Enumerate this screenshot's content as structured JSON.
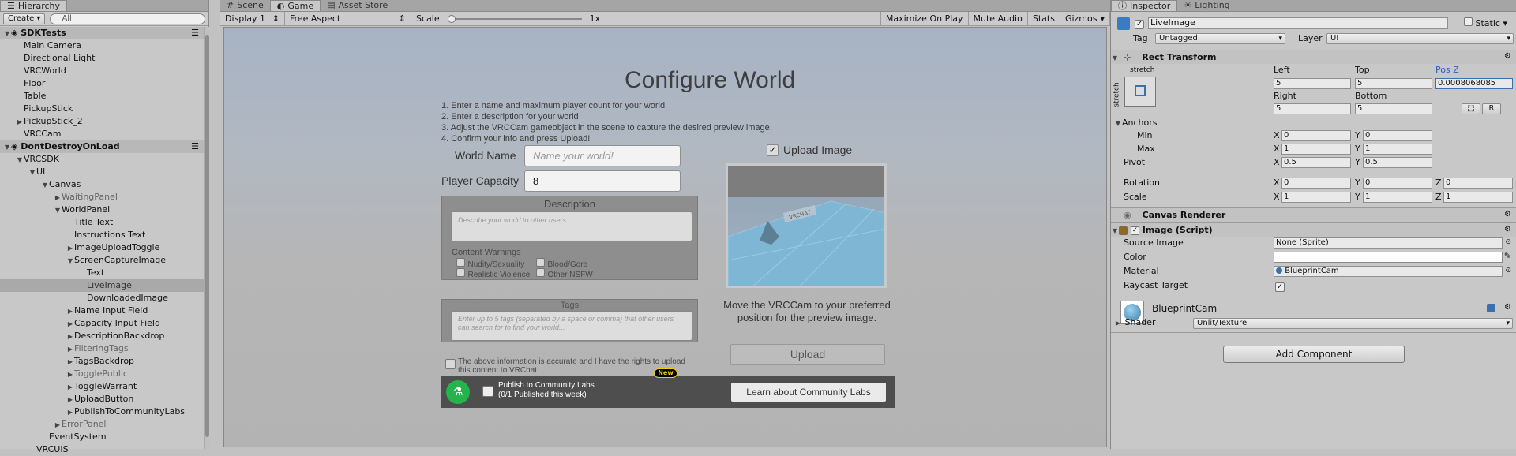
{
  "hierarchy": {
    "tab": "Hierarchy",
    "create": "Create",
    "search_placeholder": "All",
    "rows": [
      {
        "label": "SDKTests",
        "indent": 0,
        "arrow": "▼",
        "type": "header"
      },
      {
        "label": "Main Camera",
        "indent": 1
      },
      {
        "label": "Directional Light",
        "indent": 1
      },
      {
        "label": "VRCWorld",
        "indent": 1
      },
      {
        "label": "Floor",
        "indent": 1
      },
      {
        "label": "Table",
        "indent": 1
      },
      {
        "label": "PickupStick",
        "indent": 1
      },
      {
        "label": "PickupStick_2",
        "indent": 1,
        "arrow": "▶"
      },
      {
        "label": "VRCCam",
        "indent": 1
      },
      {
        "label": "DontDestroyOnLoad",
        "indent": 0,
        "arrow": "▼",
        "type": "header"
      },
      {
        "label": "VRCSDK",
        "indent": 1,
        "arrow": "▼"
      },
      {
        "label": "UI",
        "indent": 2,
        "arrow": "▼"
      },
      {
        "label": "Canvas",
        "indent": 3,
        "arrow": "▼"
      },
      {
        "label": "WaitingPanel",
        "indent": 4,
        "arrow": "▶",
        "dim": true
      },
      {
        "label": "WorldPanel",
        "indent": 4,
        "arrow": "▼"
      },
      {
        "label": "Title Text",
        "indent": 5
      },
      {
        "label": "Instructions Text",
        "indent": 5
      },
      {
        "label": "ImageUploadToggle",
        "indent": 5,
        "arrow": "▶"
      },
      {
        "label": "ScreenCaptureImage",
        "indent": 5,
        "arrow": "▼"
      },
      {
        "label": "Text",
        "indent": 6
      },
      {
        "label": "LiveImage",
        "indent": 6,
        "selected": true
      },
      {
        "label": "DownloadedImage",
        "indent": 6
      },
      {
        "label": "Name Input Field",
        "indent": 5,
        "arrow": "▶"
      },
      {
        "label": "Capacity Input Field",
        "indent": 5,
        "arrow": "▶"
      },
      {
        "label": "DescriptionBackdrop",
        "indent": 5,
        "arrow": "▶"
      },
      {
        "label": "FilteringTags",
        "indent": 5,
        "arrow": "▶",
        "dim": true
      },
      {
        "label": "TagsBackdrop",
        "indent": 5,
        "arrow": "▶"
      },
      {
        "label": "TogglePublic",
        "indent": 5,
        "arrow": "▶",
        "dim": true
      },
      {
        "label": "ToggleWarrant",
        "indent": 5,
        "arrow": "▶"
      },
      {
        "label": "UploadButton",
        "indent": 5,
        "arrow": "▶"
      },
      {
        "label": "PublishToCommunityLabs",
        "indent": 5,
        "arrow": "▶"
      },
      {
        "label": "ErrorPanel",
        "indent": 4,
        "arrow": "▶",
        "dim": true
      },
      {
        "label": "EventSystem",
        "indent": 3
      },
      {
        "label": "VRCUIS",
        "indent": 2,
        "arrow": ""
      }
    ]
  },
  "game": {
    "tabs": [
      "Scene",
      "Game",
      "Asset Store"
    ],
    "display": "Display 1",
    "aspect": "Free Aspect",
    "scale_label": "Scale",
    "scale_value": "1x",
    "buttons": [
      "Maximize On Play",
      "Mute Audio",
      "Stats",
      "Gizmos"
    ],
    "title": "Configure World",
    "instructions": [
      "1. Enter a name and maximum player count for your world",
      "2. Enter a description for your world",
      "3. Adjust the VRCCam gameobject in the scene to capture the desired preview image.",
      "4. Confirm your info and press Upload!"
    ],
    "world_name_label": "World Name",
    "world_name_placeholder": "Name your world!",
    "player_capacity_label": "Player Capacity",
    "player_capacity_value": "8",
    "description_label": "Description",
    "description_placeholder": "Describe your world to other users...",
    "content_warnings_label": "Content Warnings",
    "warnings": [
      "Nudity/Sexuality",
      "Blood/Gore",
      "Realistic Violence",
      "Other NSFW"
    ],
    "tags_label": "Tags",
    "tags_placeholder": "Enter up to 5 tags (separated by a space or comma) that other users can search for to find your world...",
    "rights_text": "The above information is accurate and I have the rights to upload this content to VRChat.",
    "new_badge": "New",
    "publish_label": "Publish to Community Labs",
    "publish_sub": "(0/1 Published this week)",
    "learn_button": "Learn about Community Labs",
    "upload_image_label": "Upload Image",
    "preview_text": "Move the VRCCam to your preferred position for the preview image.",
    "upload_button": "Upload",
    "preview_sign": "VRCHAT"
  },
  "inspector": {
    "tabs": [
      "Inspector",
      "Lighting"
    ],
    "object_name": "LiveImage",
    "static_label": "Static",
    "tag_label": "Tag",
    "tag_value": "Untagged",
    "layer_label": "Layer",
    "layer_value": "UI",
    "rect_transform": "Rect Transform",
    "stretch_top": "stretch",
    "stretch_side": "stretch",
    "left_label": "Left",
    "top_label": "Top",
    "posz_label": "Pos Z",
    "left": "5",
    "top": "5",
    "posz": "0.0008068085",
    "right_label": "Right",
    "bottom_label": "Bottom",
    "right": "5",
    "bottom": "5",
    "r_button": "R",
    "anchors": "Anchors",
    "min": "Min",
    "max": "Max",
    "min_x": "0",
    "min_y": "0",
    "max_x": "1",
    "max_y": "1",
    "pivot": "Pivot",
    "pivot_x": "0.5",
    "pivot_y": "0.5",
    "rotation": "Rotation",
    "rot_x": "0",
    "rot_y": "0",
    "rot_z": "0",
    "scale": "Scale",
    "scale_x": "1",
    "scale_y": "1",
    "scale_z": "1",
    "canvas_renderer": "Canvas Renderer",
    "image_script": "Image (Script)",
    "source_image_label": "Source Image",
    "source_image": "None (Sprite)",
    "color_label": "Color",
    "material_label": "Material",
    "material": "BlueprintCam",
    "raycast_label": "Raycast Target",
    "material_name": "BlueprintCam",
    "shader_label": "Shader",
    "shader": "Unlit/Texture",
    "add_component": "Add Component",
    "x": "X",
    "y": "Y",
    "z": "Z"
  }
}
